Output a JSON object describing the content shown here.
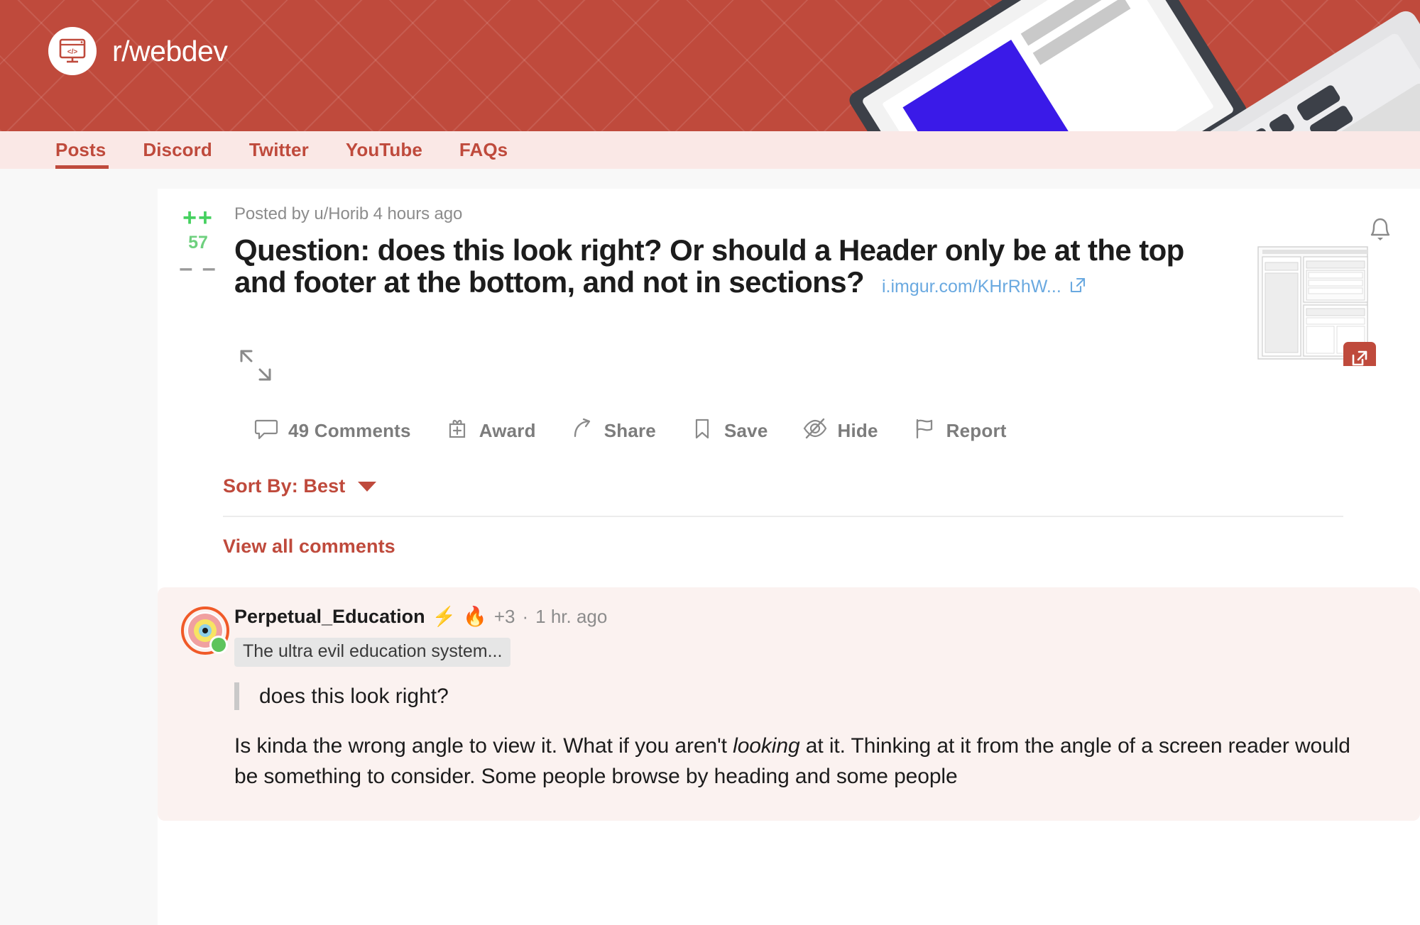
{
  "banner": {
    "subreddit_name": "r/webdev",
    "avatar_icon": "code-window-icon",
    "brand_color": "#bf4a3c",
    "illustration": "laptop-illustration"
  },
  "nav": {
    "tabs": [
      {
        "label": "Posts",
        "active": true
      },
      {
        "label": "Discord",
        "active": false
      },
      {
        "label": "Twitter",
        "active": false
      },
      {
        "label": "YouTube",
        "active": false
      },
      {
        "label": "FAQs",
        "active": false
      }
    ]
  },
  "post": {
    "vote": {
      "upvote_symbol": "++",
      "score": "57",
      "downvote_symbol": "– –",
      "upvote_color": "#46d160",
      "score_color": "#6ed07e",
      "downvote_color": "#9a9a9a"
    },
    "meta": "Posted by u/Horib 4 hours ago",
    "title": "Question: does this look right? Or should a Header only be at the top and footer at the bottom, and not in sections?",
    "link_text": "i.imgur.com/KHrRhW...",
    "link_icon": "external-link-icon",
    "bell_icon": "notification-bell-icon",
    "thumbnail": "wireframe-layout-thumbnail",
    "thumbnail_button_icon": "open-external-icon",
    "expand_icon": "expand-arrows-icon",
    "actions": [
      {
        "label": "49 Comments",
        "icon": "comment-bubble-icon"
      },
      {
        "label": "Award",
        "icon": "gift-award-icon"
      },
      {
        "label": "Share",
        "icon": "share-arrow-icon"
      },
      {
        "label": "Save",
        "icon": "bookmark-icon"
      },
      {
        "label": "Hide",
        "icon": "eye-slash-icon"
      },
      {
        "label": "Report",
        "icon": "flag-icon"
      }
    ]
  },
  "comments_section": {
    "sort_label": "Sort By: Best",
    "sort_caret_icon": "chevron-down-icon",
    "view_all_label": "View all comments"
  },
  "comment": {
    "avatar_icon": "concentric-rings-avatar",
    "online_status": "online",
    "author": "Perpetual_Education",
    "badges": [
      "⚡",
      "🔥"
    ],
    "badge_count": "+3",
    "separator": "·",
    "timestamp": "1 hr. ago",
    "flair": "The ultra evil education system...",
    "quote": "does this look right?",
    "body_before_italic": "Is kinda the wrong angle to view it. What if you aren't ",
    "body_italic": "looking",
    "body_after_italic": " at it. Thinking at it from the angle of a screen reader would be something to consider. Some people browse by heading and some people"
  }
}
